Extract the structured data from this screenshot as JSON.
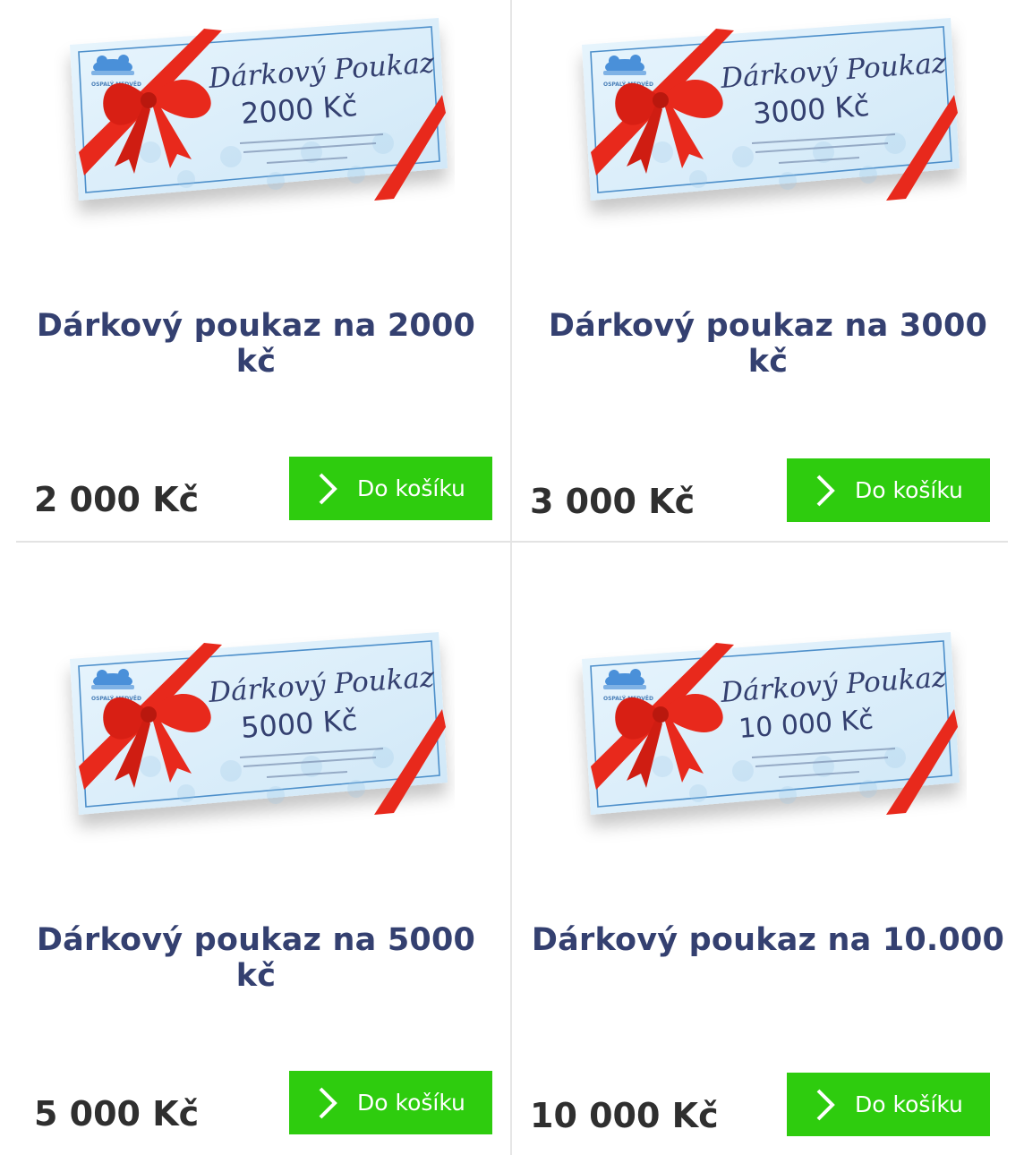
{
  "products": [
    {
      "name": "Dárkový poukaz na 2000 kč",
      "price": "2 000 Kč",
      "button_label": "Do košíku",
      "voucher": {
        "logo_text": "OSPALÝ MEDVĚD",
        "heading": "Dárkový Poukaz",
        "amount": "2000 Kč"
      }
    },
    {
      "name": "Dárkový poukaz na 3000 kč",
      "price": "3 000 Kč",
      "button_label": "Do košíku",
      "voucher": {
        "logo_text": "OSPALÝ MEDVĚD",
        "heading": "Dárkový Poukaz",
        "amount": "3000 Kč"
      }
    },
    {
      "name": "Dárkový poukaz na 5000 kč",
      "price": "5 000 Kč",
      "button_label": "Do košíku",
      "voucher": {
        "logo_text": "OSPALÝ MEDVĚD",
        "heading": "Dárkový Poukaz",
        "amount": "5000 Kč"
      }
    },
    {
      "name": "Dárkový poukaz na 10.000",
      "price": "10 000 Kč",
      "button_label": "Do košíku",
      "voucher": {
        "logo_text": "OSPALÝ MEDVĚD",
        "heading": "Dárkový Poukaz",
        "amount": "10 000 Kč"
      }
    }
  ],
  "colors": {
    "title": "#344070",
    "price": "#2f2f2f",
    "button_bg": "#2ecc0e",
    "button_text": "#ffffff",
    "voucher_bg": "#dff0fb",
    "ribbon": "#e8291c"
  },
  "icons": {
    "button_icon": "chevron-right-icon"
  }
}
